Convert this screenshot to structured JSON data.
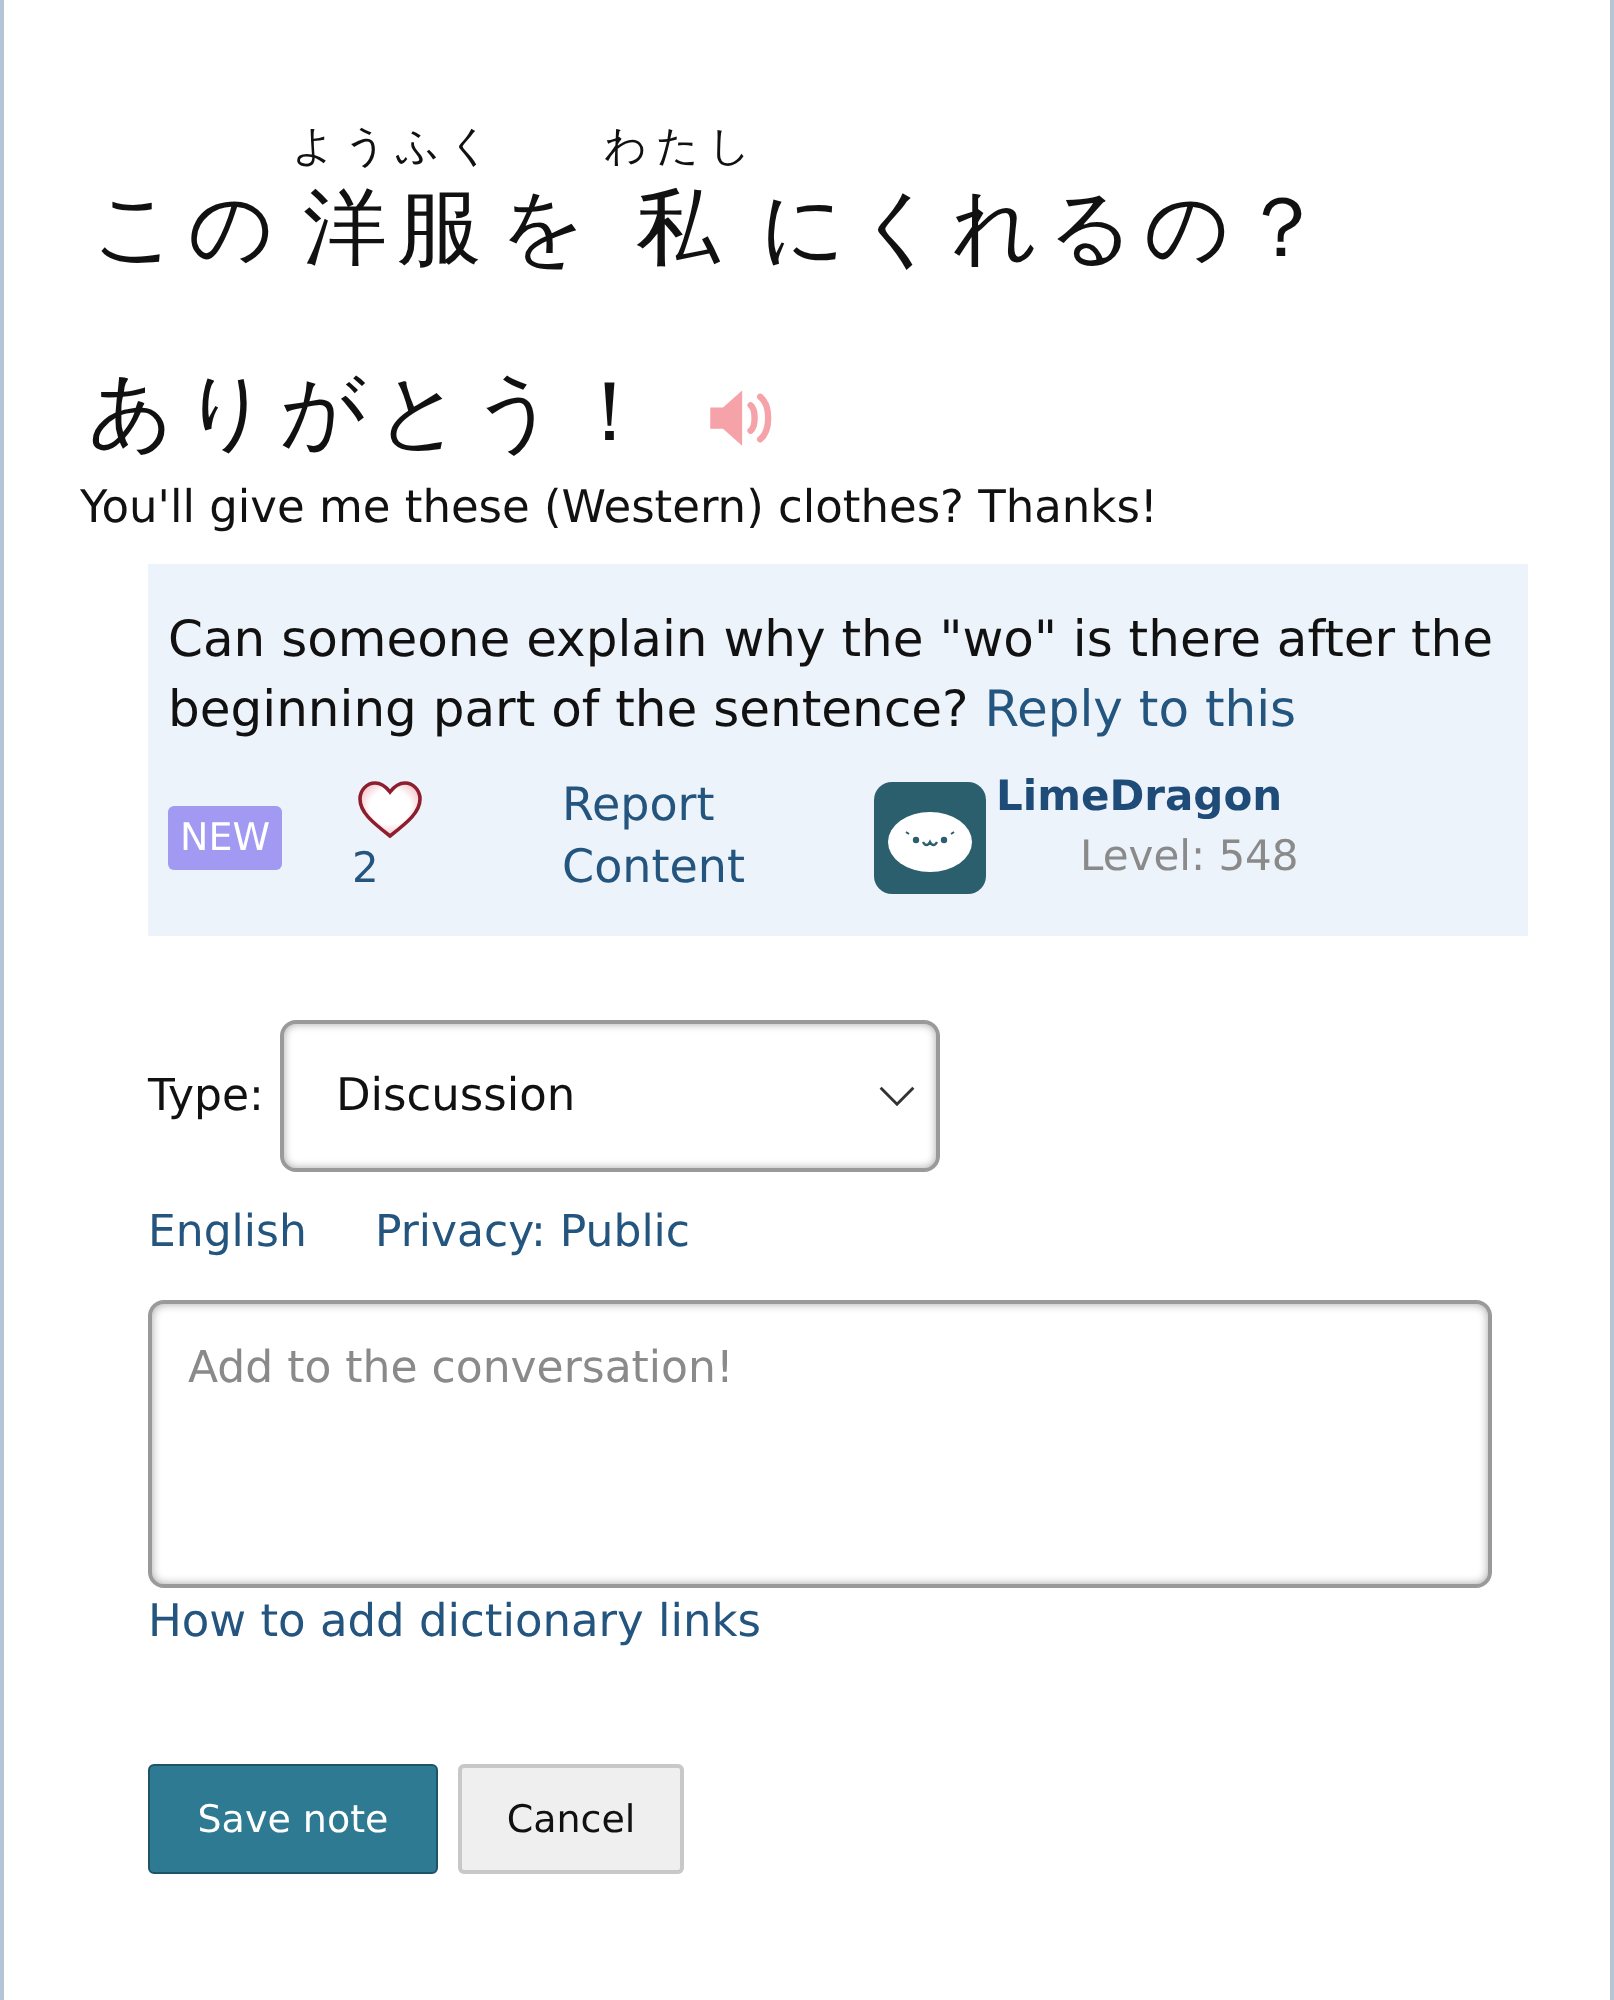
{
  "sentence": {
    "line_1": [
      {
        "text": "この"
      },
      {
        "text": "洋服",
        "reading": "ようふく"
      },
      {
        "text": "を"
      },
      {
        "text": "私",
        "reading": "わたし"
      },
      {
        "text": "にくれるの？"
      }
    ],
    "line_2": "ありがとう！",
    "translation": "You'll give me these (Western) clothes? Thanks!"
  },
  "note": {
    "text": "Can someone explain why the \"wo\" is there after the beginning part of the sentence?",
    "reply_link": "Reply to this",
    "badge": "NEW",
    "liked": false,
    "likes": "2",
    "report_link": "Report Content",
    "author": {
      "name": "LimeDragon",
      "level": "Level: 548"
    }
  },
  "form": {
    "type_label": "Type:",
    "type_value": "Discussion",
    "language_link": "English",
    "privacy_link": "Privacy: Public",
    "comment": {
      "placeholder": "Add to the conversation!"
    },
    "help_link": "How to add dictionary links",
    "buttons": [
      {
        "label": "Save note",
        "kind": "primary"
      },
      {
        "label": "Cancel",
        "kind": "secondary"
      }
    ]
  }
}
